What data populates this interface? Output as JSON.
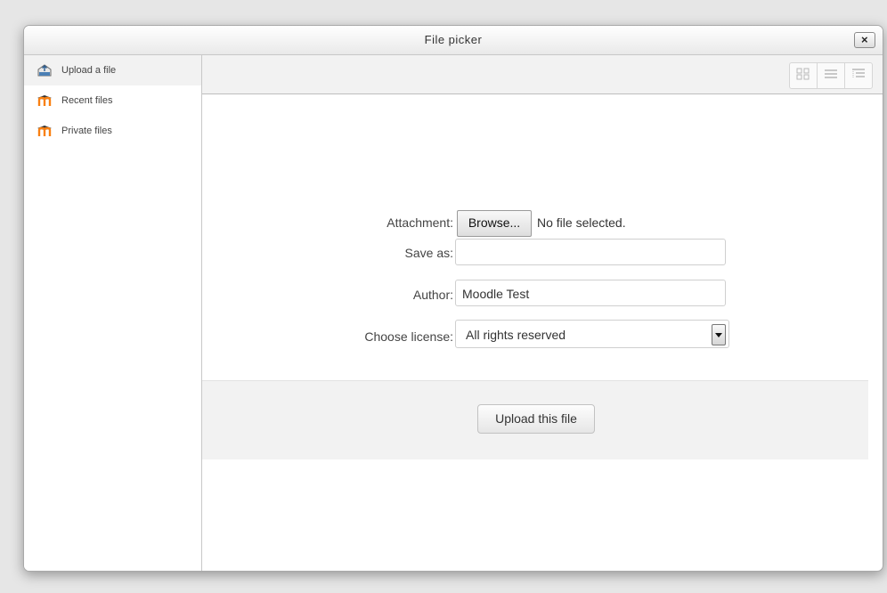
{
  "dialog": {
    "title": "File picker",
    "close_label": "×"
  },
  "sidebar": {
    "items": [
      {
        "label": "Upload a file",
        "icon": "upload-icon"
      },
      {
        "label": "Recent files",
        "icon": "moodle-icon"
      },
      {
        "label": "Private files",
        "icon": "moodle-icon"
      }
    ]
  },
  "toolbar": {
    "views": [
      "icons-view-icon",
      "list-view-icon",
      "tree-view-icon"
    ]
  },
  "form": {
    "attachment_label": "Attachment:",
    "browse_label": "Browse...",
    "no_file_text": "No file selected.",
    "saveas_label": "Save as:",
    "saveas_value": "",
    "author_label": "Author:",
    "author_value": "Moodle Test",
    "license_label": "Choose license:",
    "license_value": "All rights reserved",
    "upload_label": "Upload this file"
  },
  "colors": {
    "moodle_orange": "#f98012",
    "link_text": "#444444"
  }
}
